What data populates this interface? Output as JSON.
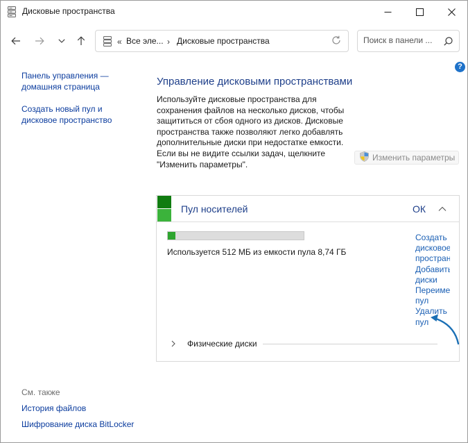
{
  "window": {
    "title": "Дисковые пространства"
  },
  "address": {
    "overflow": "«",
    "crumbs": [
      "Все эле...",
      "Дисковые пространства"
    ]
  },
  "search": {
    "placeholder": "Поиск в панели ..."
  },
  "help": {
    "glyph": "?"
  },
  "sidebar": {
    "links": [
      {
        "line1": "Панель управления —",
        "line2": "домашняя страница"
      },
      {
        "line1": "Создать новый пул и",
        "line2": "дисковое пространство"
      }
    ],
    "see_also": {
      "heading": "См. также",
      "links": [
        "История файлов",
        "Шифрование диска BitLocker"
      ]
    }
  },
  "main": {
    "title": "Управление дисковыми пространствами",
    "description_lines": [
      "Используйте дисковые пространства для",
      "сохранения файлов на несколько дисков, чтобы",
      "защититься от сбоя одного из дисков. Дисковые",
      "пространства также позволяют легко добавлять",
      "дополнительные диски при недостатке емкости.",
      "Если вы не видите ссылки задач, щелкните",
      "\"Изменить параметры\"."
    ],
    "change_settings_label": "Изменить параметры"
  },
  "pool": {
    "name": "Пул носителей",
    "status": "ОК",
    "usage_fraction": 0.057,
    "usage_text": "Используется 512 МБ из емкости пула 8,74 ГБ",
    "task_links": [
      {
        "line1": "Создать",
        "line2": "дисковое",
        "line3": "пространство"
      },
      {
        "line1": "Добавить",
        "line2": "диски"
      },
      {
        "line1": "Переименовать",
        "line2": "пул"
      },
      {
        "line1": "Удалить",
        "line2": "пул"
      }
    ],
    "physical_disks_label": "Физические диски"
  },
  "colors": {
    "link": "#0b3c9e",
    "heading": "#1e3f8a",
    "usage_fill": "#2ea52f",
    "pool_icon_dark": "#107c10",
    "pool_icon_light": "#3bb33b",
    "arrow": "#1a6fb5"
  },
  "icons": {
    "app": "disk-spaces-icon",
    "back": "back-arrow-icon",
    "forward": "forward-arrow-icon",
    "recent": "chevron-down-icon",
    "up": "up-arrow-icon",
    "refresh": "refresh-icon",
    "search": "search-icon",
    "shield": "uac-shield-icon"
  }
}
